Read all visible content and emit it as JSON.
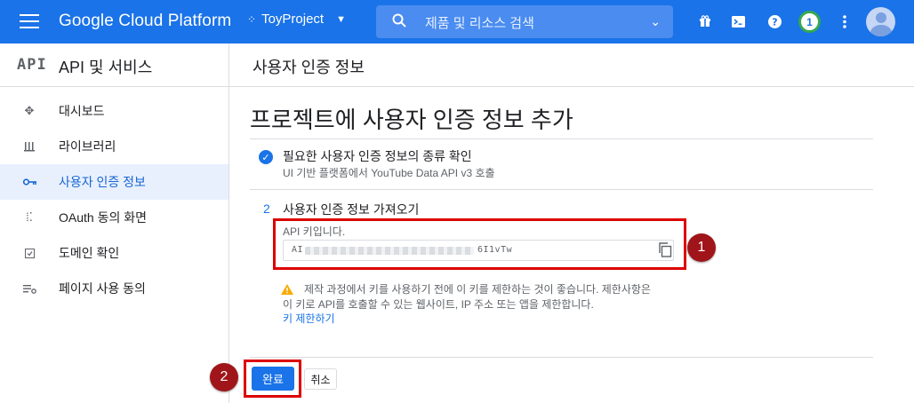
{
  "header": {
    "brand": "Google Cloud Platform",
    "project": "ToyProject",
    "search_placeholder": "제품 및 리소스 검색",
    "notification_count": "1",
    "icons": [
      "menu-icon",
      "project-dots-icon",
      "search-icon",
      "gift-icon",
      "terminal-icon",
      "help-icon",
      "more-icon",
      "avatar"
    ],
    "colors": {
      "bar": "#1a73e8",
      "notif_ring": "#34a853"
    }
  },
  "sidebar": {
    "logo": "API",
    "title": "API 및 서비스",
    "items": [
      {
        "label": "대시보드",
        "icon": "dashboard-icon",
        "active": false
      },
      {
        "label": "라이브러리",
        "icon": "library-icon",
        "active": false
      },
      {
        "label": "사용자 인증 정보",
        "icon": "key-icon",
        "active": true
      },
      {
        "label": "OAuth 동의 화면",
        "icon": "oauth-icon",
        "active": false
      },
      {
        "label": "도메인 확인",
        "icon": "domain-check-icon",
        "active": false
      },
      {
        "label": "페이지 사용 동의",
        "icon": "page-consent-icon",
        "active": false
      }
    ]
  },
  "main": {
    "breadcrumb": "사용자 인증 정보",
    "page_title": "프로젝트에 사용자 인증 정보 추가",
    "step1": {
      "title": "필요한 사용자 인증 정보의 종류 확인",
      "subtitle": "UI 기반 플랫폼에서 YouTube Data API v3 호출"
    },
    "step2": {
      "number": "2",
      "title": "사용자 인증 정보 가져오기",
      "key_label": "API 키입니다.",
      "key_prefix": "AI",
      "key_suffix": "6I1vTw"
    },
    "warning": {
      "line1": "제작 과정에서 키를 사용하기 전에 이 키를 제한하는 것이 좋습니다. 제한사항은",
      "line2": "이 키로 API를 호출할 수 있는 웹사이트, IP 주소 또는 앱을 제한합니다.",
      "link": "키 제한하기"
    },
    "buttons": {
      "done": "완료",
      "cancel": "취소"
    }
  },
  "annotations": {
    "badge1": "1",
    "badge2": "2",
    "highlight_color": "#dd0000",
    "badge_color": "#a0151a"
  }
}
